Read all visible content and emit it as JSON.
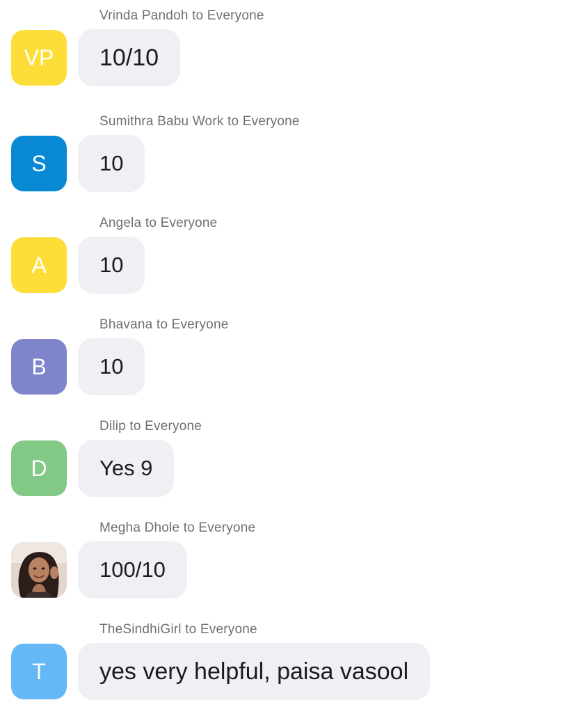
{
  "messages": [
    {
      "sender": "Vrinda Pandoh to Everyone",
      "initials": "VP",
      "color": "#fddd38",
      "text": "10/10"
    },
    {
      "sender": "Sumithra Babu Work to Everyone",
      "initials": "S",
      "color": "#0989d3",
      "text": "10"
    },
    {
      "sender": "Angela to Everyone",
      "initials": "A",
      "color": "#fddd38",
      "text": "10"
    },
    {
      "sender": "Bhavana to Everyone",
      "initials": "B",
      "color": "#7f85cb",
      "text": "10"
    },
    {
      "sender": "Dilip to Everyone",
      "initials": "D",
      "color": "#83c986",
      "text": "Yes 9"
    },
    {
      "sender": "Megha Dhole to Everyone",
      "initials": "",
      "color": "",
      "avatar_icon": "profile-photo-icon",
      "text": "100/10"
    },
    {
      "sender": "TheSindhiGirl to Everyone",
      "initials": "T",
      "color": "#65b8f6",
      "text": "yes very helpful, paisa vasool"
    }
  ]
}
